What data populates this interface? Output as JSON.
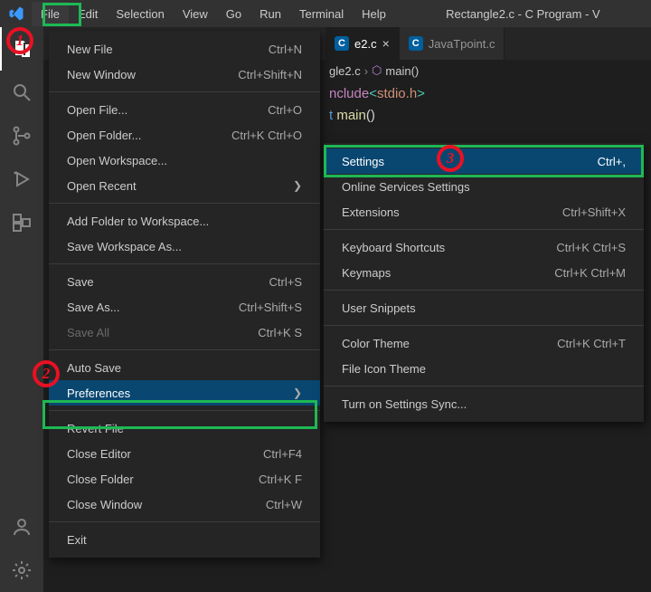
{
  "titlebar": {
    "title": "Rectangle2.c - C Program - V",
    "menus": [
      "File",
      "Edit",
      "Selection",
      "View",
      "Go",
      "Run",
      "Terminal",
      "Help"
    ]
  },
  "activitybar": {
    "items": [
      "explorer",
      "search",
      "scm",
      "debug",
      "extensions"
    ],
    "bottom": [
      "account",
      "gear"
    ]
  },
  "tabs": [
    {
      "label": "e2.c",
      "lang": "C",
      "active": true
    },
    {
      "label": "JavaTpoint.c",
      "lang": "C",
      "active": false
    }
  ],
  "breadcrumb": {
    "file": "gle2.c",
    "symbol": "main()"
  },
  "editor": {
    "include_kw": "nclude",
    "include_open": "<",
    "include_lib": "stdio.h",
    "include_close": ">",
    "ret_type": "t",
    "func_name": "main",
    "parens": "()"
  },
  "fileMenu": [
    {
      "type": "item",
      "label": "New File",
      "shortcut": "Ctrl+N"
    },
    {
      "type": "item",
      "label": "New Window",
      "shortcut": "Ctrl+Shift+N"
    },
    {
      "type": "sep"
    },
    {
      "type": "item",
      "label": "Open File...",
      "shortcut": "Ctrl+O"
    },
    {
      "type": "item",
      "label": "Open Folder...",
      "shortcut": "Ctrl+K Ctrl+O"
    },
    {
      "type": "item",
      "label": "Open Workspace..."
    },
    {
      "type": "submenu",
      "label": "Open Recent"
    },
    {
      "type": "sep"
    },
    {
      "type": "item",
      "label": "Add Folder to Workspace..."
    },
    {
      "type": "item",
      "label": "Save Workspace As..."
    },
    {
      "type": "sep"
    },
    {
      "type": "item",
      "label": "Save",
      "shortcut": "Ctrl+S"
    },
    {
      "type": "item",
      "label": "Save As...",
      "shortcut": "Ctrl+Shift+S"
    },
    {
      "type": "item",
      "label": "Save All",
      "shortcut": "Ctrl+K S",
      "disabled": true
    },
    {
      "type": "sep"
    },
    {
      "type": "item",
      "label": "Auto Save"
    },
    {
      "type": "submenu",
      "label": "Preferences",
      "hl": true
    },
    {
      "type": "sep"
    },
    {
      "type": "item",
      "label": "Revert File"
    },
    {
      "type": "item",
      "label": "Close Editor",
      "shortcut": "Ctrl+F4"
    },
    {
      "type": "item",
      "label": "Close Folder",
      "shortcut": "Ctrl+K F"
    },
    {
      "type": "item",
      "label": "Close Window",
      "shortcut": "Ctrl+W"
    },
    {
      "type": "sep"
    },
    {
      "type": "item",
      "label": "Exit"
    }
  ],
  "prefsMenu": [
    {
      "type": "item",
      "label": "Settings",
      "shortcut": "Ctrl+,",
      "hl": true
    },
    {
      "type": "item",
      "label": "Online Services Settings"
    },
    {
      "type": "item",
      "label": "Extensions",
      "shortcut": "Ctrl+Shift+X"
    },
    {
      "type": "sep"
    },
    {
      "type": "item",
      "label": "Keyboard Shortcuts",
      "shortcut": "Ctrl+K Ctrl+S"
    },
    {
      "type": "item",
      "label": "Keymaps",
      "shortcut": "Ctrl+K Ctrl+M"
    },
    {
      "type": "sep"
    },
    {
      "type": "item",
      "label": "User Snippets"
    },
    {
      "type": "sep"
    },
    {
      "type": "item",
      "label": "Color Theme",
      "shortcut": "Ctrl+K Ctrl+T"
    },
    {
      "type": "item",
      "label": "File Icon Theme"
    },
    {
      "type": "sep"
    },
    {
      "type": "item",
      "label": "Turn on Settings Sync..."
    }
  ],
  "annotations": {
    "ring1": "1",
    "ring2": "2",
    "ring3": "3"
  }
}
